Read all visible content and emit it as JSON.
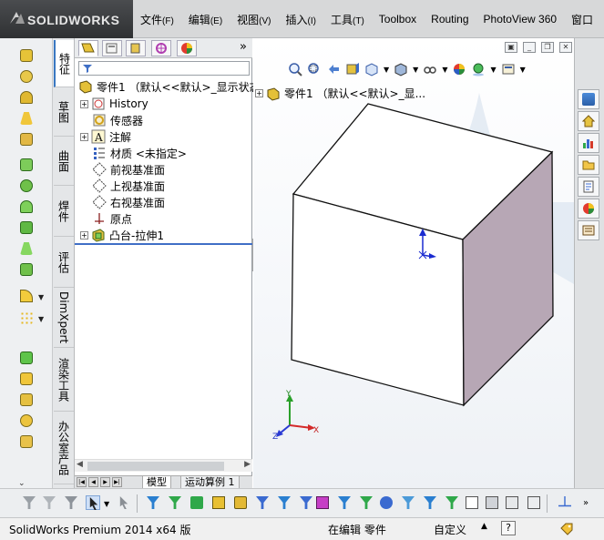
{
  "app": {
    "brand": "SOLIDWORKS"
  },
  "menu": [
    {
      "label": "文件",
      "hotkey": "(F)"
    },
    {
      "label": "编辑",
      "hotkey": "(E)"
    },
    {
      "label": "视图",
      "hotkey": "(V)"
    },
    {
      "label": "插入",
      "hotkey": "(I)"
    },
    {
      "label": "工具",
      "hotkey": "(T)"
    },
    {
      "label": "Toolbox",
      "hotkey": ""
    },
    {
      "label": "Routing",
      "hotkey": ""
    },
    {
      "label": "PhotoView 360",
      "hotkey": ""
    },
    {
      "label": "窗口",
      "hotkey": ""
    }
  ],
  "vertical_tabs": [
    "特征",
    "草图",
    "曲面",
    "焊件",
    "评估",
    "DimXpert",
    "渲染工具",
    "办公室产品"
  ],
  "feature_manager": {
    "more": "»",
    "root": "零件1 （默认<<默认>_显示状态",
    "nodes": [
      {
        "label": "History",
        "expandable": true
      },
      {
        "label": "传感器",
        "expandable": false
      },
      {
        "label": "注解",
        "expandable": true
      },
      {
        "label": "材质 <未指定>",
        "expandable": false
      },
      {
        "label": "前视基准面",
        "expandable": false
      },
      {
        "label": "上视基准面",
        "expandable": false
      },
      {
        "label": "右视基准面",
        "expandable": false
      },
      {
        "label": "原点",
        "expandable": false
      },
      {
        "label": "凸台-拉伸1",
        "expandable": true
      }
    ]
  },
  "model_tabs": {
    "model": "模型",
    "motion": "运动算例 1"
  },
  "viewport": {
    "tree_label": "零件1 （默认<<默认>_显...",
    "triad": {
      "x": "X",
      "y": "Y",
      "z": "Z"
    }
  },
  "status_bar": {
    "product": "SolidWorks Premium 2014 x64 版",
    "mode": "在编辑 零件",
    "units": "自定义",
    "help": "?"
  },
  "colors": {
    "accent": "#3f6fc6",
    "cube_top": "#ffffff",
    "cube_front": "#ffffff",
    "cube_right": "#b7a7b5"
  }
}
